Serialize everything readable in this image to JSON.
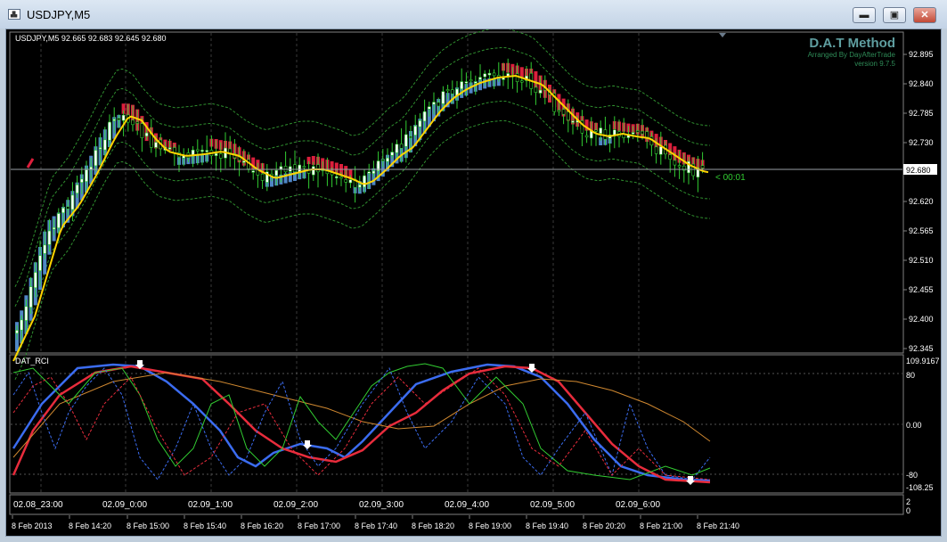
{
  "window": {
    "title": "USDJPY,M5",
    "icon": "chart-window-icon",
    "minimize_label": "▬",
    "restore_label": "▣",
    "close_label": "✕"
  },
  "main_chart": {
    "info_line": "USDJPY,M5  92.665 92.683 92.645 92.680",
    "brand_title": "D.A.T Method",
    "brand_subtitle": "Arranged By DayAfterTrade",
    "brand_version": "version 9.7.5",
    "countdown": "< 00:01",
    "current_price": "92.680",
    "price_labels": [
      "92.895",
      "92.840",
      "92.785",
      "92.730",
      "92.620",
      "92.565",
      "92.510",
      "92.455",
      "92.400",
      "92.345"
    ],
    "colors": {
      "bull": "#4f86c6",
      "bear": "#dc1f3c",
      "wick_green": "#32cd32",
      "body_white": "#ffffff",
      "ma": "#ffd400",
      "band": "#2f8f2f",
      "grid": "#3a3a3a",
      "axis_text": "#ffffff"
    }
  },
  "indicator": {
    "label": "DAT_RCI",
    "scale_labels": [
      "109.9167",
      "80",
      "0.00",
      "-80",
      "-108.25"
    ],
    "colors": {
      "blue": "#3b6cf0",
      "red": "#e82c3c",
      "green": "#32cd32",
      "orange": "#d08830"
    }
  },
  "time_panel": {
    "scale_labels": [
      "2",
      "0"
    ],
    "labels": [
      "02.08_23:00",
      "02.09_0:00",
      "02.09_1:00",
      "02.09_2:00",
      "02.09_3:00",
      "02.09_4:00",
      "02.09_5:00",
      "02.09_6:00"
    ]
  },
  "x_axis": {
    "labels": [
      "8 Feb 2013",
      "8 Feb 14:20",
      "8 Feb 15:00",
      "8 Feb 15:40",
      "8 Feb 16:20",
      "8 Feb 17:00",
      "8 Feb 17:40",
      "8 Feb 18:20",
      "8 Feb 19:00",
      "8 Feb 19:40",
      "8 Feb 20:20",
      "8 Feb 21:00",
      "8 Feb 21:40"
    ]
  }
}
